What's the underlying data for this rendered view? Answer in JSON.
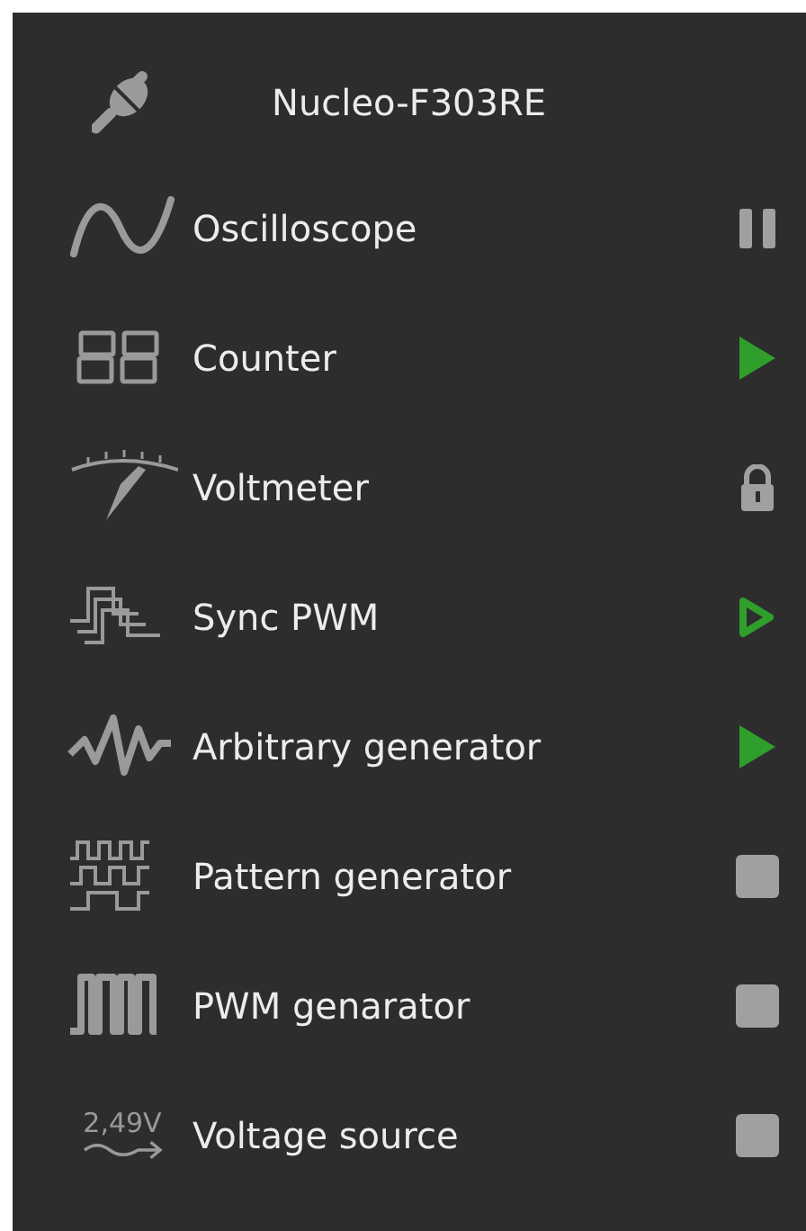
{
  "device": {
    "name": "Nucleo-F303RE",
    "kind": "plug"
  },
  "instruments": [
    {
      "name": "Oscilloscope",
      "kind": "sine",
      "status": {
        "kind": "paused"
      }
    },
    {
      "name": "Counter",
      "kind": "digits",
      "status": {
        "kind": "running"
      }
    },
    {
      "name": "Voltmeter",
      "kind": "gauge",
      "status": {
        "kind": "locked"
      }
    },
    {
      "name": "Sync PWM",
      "kind": "steps",
      "status": {
        "kind": "ready"
      }
    },
    {
      "name": "Arbitrary generator",
      "kind": "zigzag",
      "status": {
        "kind": "running"
      }
    },
    {
      "name": "Pattern generator",
      "kind": "pattern",
      "status": {
        "kind": "stopped"
      }
    },
    {
      "name": "PWM genarator",
      "kind": "pulses",
      "status": {
        "kind": "stopped"
      }
    },
    {
      "name": "Voltage source",
      "kind": "voltage",
      "icon_text": "2,49V",
      "status": {
        "kind": "stopped"
      }
    }
  ]
}
